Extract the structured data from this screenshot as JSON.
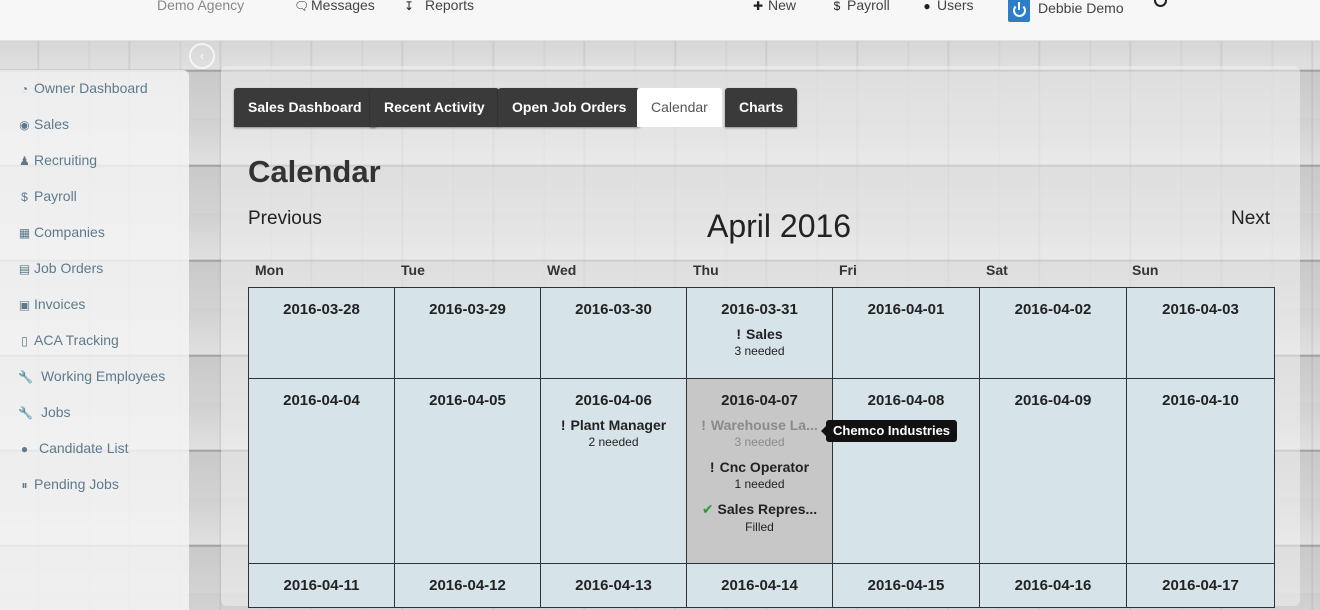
{
  "topbar": {
    "brand": "Demo Agency",
    "messages": "Messages",
    "reports": "Reports",
    "new": "New",
    "payroll": "Payroll",
    "users": "Users",
    "user_name": "Debbie Demo"
  },
  "sidebar": {
    "items": [
      {
        "label": "Owner Dashboard",
        "icon": "dashboard-icon"
      },
      {
        "label": "Sales",
        "icon": "globe-icon"
      },
      {
        "label": "Recruiting",
        "icon": "person-icon"
      },
      {
        "label": "Payroll",
        "icon": "dollar-icon"
      },
      {
        "label": "Companies",
        "icon": "building-icon"
      },
      {
        "label": "Job Orders",
        "icon": "briefcase-icon"
      },
      {
        "label": "Invoices",
        "icon": "money-icon"
      },
      {
        "label": "ACA Tracking",
        "icon": "file-icon"
      },
      {
        "label": "Working Employees",
        "icon": "wrench-icon"
      },
      {
        "label": "Jobs",
        "icon": "wrench-icon"
      },
      {
        "label": "Candidate List",
        "icon": "users-icon"
      },
      {
        "label": "Pending Jobs",
        "icon": "pause-icon"
      }
    ]
  },
  "tabs": [
    {
      "label": "Sales Dashboard",
      "active": false
    },
    {
      "label": "Recent Activity",
      "active": false
    },
    {
      "label": "Open Job Orders",
      "active": false
    },
    {
      "label": "Calendar",
      "active": true
    },
    {
      "label": "Charts",
      "active": false
    }
  ],
  "page_title": "Calendar",
  "calendar": {
    "prev_label": "Previous",
    "next_label": "Next",
    "month_title": "April 2016",
    "days": [
      "Mon",
      "Tue",
      "Wed",
      "Thu",
      "Fri",
      "Sat",
      "Sun"
    ],
    "weeks": [
      [
        {
          "date": "2016-03-28"
        },
        {
          "date": "2016-03-29"
        },
        {
          "date": "2016-03-30"
        },
        {
          "date": "2016-03-31",
          "events": [
            {
              "title": "Sales",
              "sub": "3 needed",
              "status": "needed"
            }
          ]
        },
        {
          "date": "2016-04-01"
        },
        {
          "date": "2016-04-02"
        },
        {
          "date": "2016-04-03"
        }
      ],
      [
        {
          "date": "2016-04-04"
        },
        {
          "date": "2016-04-05"
        },
        {
          "date": "2016-04-06",
          "events": [
            {
              "title": "Plant Manager",
              "sub": "2 needed",
              "status": "needed"
            }
          ]
        },
        {
          "date": "2016-04-07",
          "highlighted": true,
          "events": [
            {
              "title": "Warehouse La...",
              "sub": "3 needed",
              "status": "needed",
              "dim": true
            },
            {
              "title": "Cnc Operator",
              "sub": "1 needed",
              "status": "needed"
            },
            {
              "title": "Sales Repres...",
              "sub": "Filled",
              "status": "filled"
            }
          ]
        },
        {
          "date": "2016-04-08"
        },
        {
          "date": "2016-04-09"
        },
        {
          "date": "2016-04-10"
        }
      ],
      [
        {
          "date": "2016-04-11"
        },
        {
          "date": "2016-04-12"
        },
        {
          "date": "2016-04-13"
        },
        {
          "date": "2016-04-14"
        },
        {
          "date": "2016-04-15"
        },
        {
          "date": "2016-04-16"
        },
        {
          "date": "2016-04-17"
        }
      ]
    ],
    "tooltip": "Chemco Industries"
  },
  "colors": {
    "cell_bg": "#d6e3e8",
    "highlight_bg": "#c7c7c7",
    "tab_bg": "#3a3a3a",
    "sidebar_link": "#5d7a8d",
    "filled_check": "#2a9a3c"
  }
}
